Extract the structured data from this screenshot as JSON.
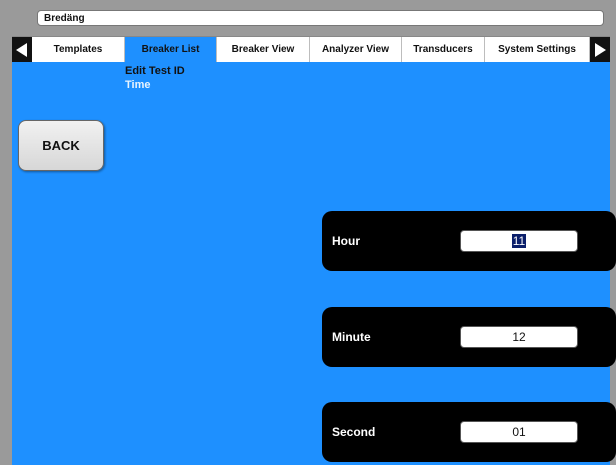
{
  "title_bar": {
    "text": "Bredäng"
  },
  "tabs": [
    {
      "label": "Templates",
      "active": false
    },
    {
      "label": "Breaker List",
      "active": true
    },
    {
      "label": "Breaker View",
      "active": false
    },
    {
      "label": "Analyzer View",
      "active": false
    },
    {
      "label": "Transducers",
      "active": false
    },
    {
      "label": "System Settings",
      "active": false
    }
  ],
  "submenu": {
    "item1": "Edit Test ID",
    "item2": "Time"
  },
  "back_button": {
    "label": "BACK"
  },
  "fields": {
    "hour": {
      "label": "Hour",
      "value": "11"
    },
    "minute": {
      "label": "Minute",
      "value": "12"
    },
    "second": {
      "label": "Second",
      "value": "01"
    }
  },
  "colors": {
    "background": "#1e90ff",
    "panel": "#000000",
    "frame": "#9a9a9a"
  },
  "icons": {
    "nav_left": "triangle-left",
    "nav_right": "triangle-right"
  }
}
